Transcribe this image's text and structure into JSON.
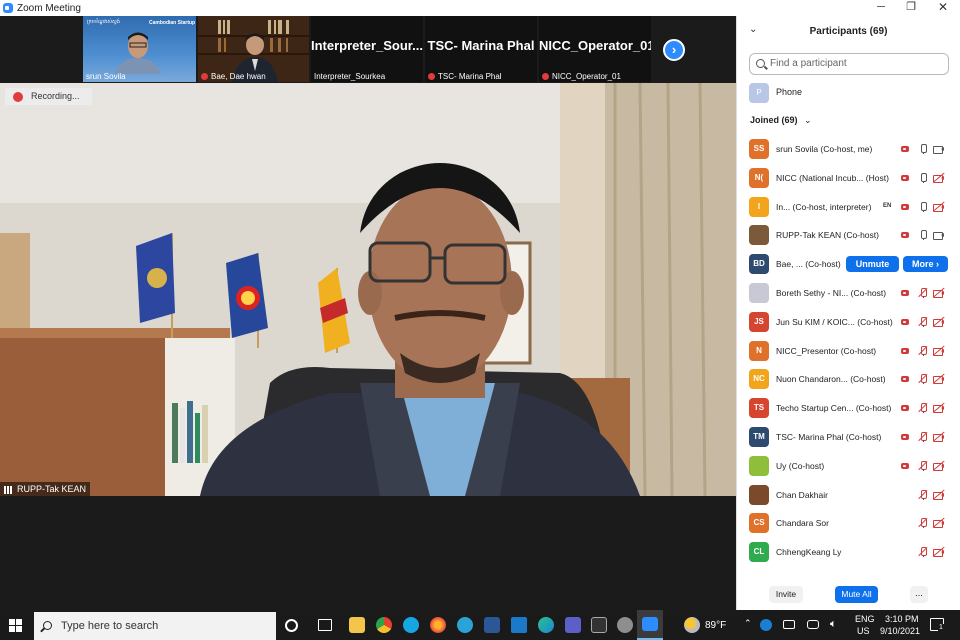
{
  "window": {
    "title": "Zoom Meeting"
  },
  "strip": {
    "thumbs": [
      {
        "name": "srun Sovila",
        "banner_left": "ក្របខ័ណ្ឌវាស់ស្ទង់",
        "banner_right": "Cambodian Startup"
      },
      {
        "name": "Bae, Dae hwan"
      },
      {
        "name": "Interpreter_Sourkea",
        "big": "Interpreter_Sour..."
      },
      {
        "name": "TSC- Marina Phal",
        "big": "TSC- Marina Phal"
      },
      {
        "name": "NICC_Operator_01",
        "big": "NICC_Operator_01"
      }
    ]
  },
  "main": {
    "recording_label": "Recording...",
    "speaker_name": "RUPP-Tak KEAN"
  },
  "participants": {
    "header": "Participants (69)",
    "search_placeholder": "Find a participant",
    "phone_avatar": "P",
    "phone_label": "Phone",
    "joined_label": "Joined (69)",
    "list": [
      {
        "initials": "SS",
        "color": "#e0712b",
        "name": "srun Sovila (Co-host, me)",
        "rec": true,
        "mic": "on",
        "cam": "on"
      },
      {
        "initials": "N(",
        "color": "#e0712b",
        "name": "NICC (National Incub... (Host)",
        "rec": true,
        "mic": "on",
        "cam": "off"
      },
      {
        "initials": "I",
        "color": "#f2a51a",
        "name": "In... (Co-host, interpreter)",
        "rec": true,
        "en": "EN",
        "mic": "on",
        "cam": "off"
      },
      {
        "initials": "",
        "color": "#7a5a3a",
        "photo": true,
        "name": "RUPP-Tak KEAN (Co-host)",
        "rec": true,
        "mic": "on",
        "cam": "on"
      },
      {
        "initials": "BD",
        "color": "#2e4a6e",
        "name": "Bae, ... (Co-host)",
        "unmute": "Unmute",
        "more": "More ›"
      },
      {
        "initials": "",
        "color": "#c9c9d6",
        "photo": true,
        "name": "Boreth Sethy - NI... (Co-host)",
        "rec": true,
        "mic": "off",
        "cam": "off"
      },
      {
        "initials": "JS",
        "color": "#d64530",
        "name": "Jun Su KIM / KOIC... (Co-host)",
        "rec": true,
        "mic": "off",
        "cam": "off"
      },
      {
        "initials": "N",
        "color": "#e0712b",
        "name": "NICC_Presentor (Co-host)",
        "rec": true,
        "mic": "off",
        "cam": "off"
      },
      {
        "initials": "NC",
        "color": "#f2a51a",
        "name": "Nuon Chandaron... (Co-host)",
        "rec": true,
        "mic": "off",
        "cam": "off"
      },
      {
        "initials": "TS",
        "color": "#d64530",
        "name": "Techo Startup Cen... (Co-host)",
        "rec": true,
        "mic": "off",
        "cam": "off"
      },
      {
        "initials": "TM",
        "color": "#2e4a6e",
        "name": "TSC- Marina Phal (Co-host)",
        "rec": true,
        "mic": "off",
        "cam": "off"
      },
      {
        "initials": "",
        "color": "#8fbf3a",
        "photo": true,
        "name": "Uy (Co-host)",
        "rec": true,
        "mic": "off",
        "cam": "off"
      },
      {
        "initials": "",
        "color": "#7a4a2a",
        "photo": true,
        "name": "Chan Dakhair",
        "mic": "off",
        "cam": "off"
      },
      {
        "initials": "CS",
        "color": "#e0712b",
        "name": "Chandara Sor",
        "mic": "off",
        "cam": "off"
      },
      {
        "initials": "CL",
        "color": "#2faa4e",
        "name": "ChhengKeang Ly",
        "mic": "off",
        "cam": "off"
      }
    ],
    "invite_label": "Invite",
    "mute_all_label": "Mute All",
    "more_label": "..."
  },
  "taskbar": {
    "search_placeholder": "Type here to search",
    "temperature": "89°F",
    "lang_top": "ENG",
    "lang_bottom": "US",
    "time": "3:10 PM",
    "date": "9/10/2021",
    "notif_count": "1"
  }
}
